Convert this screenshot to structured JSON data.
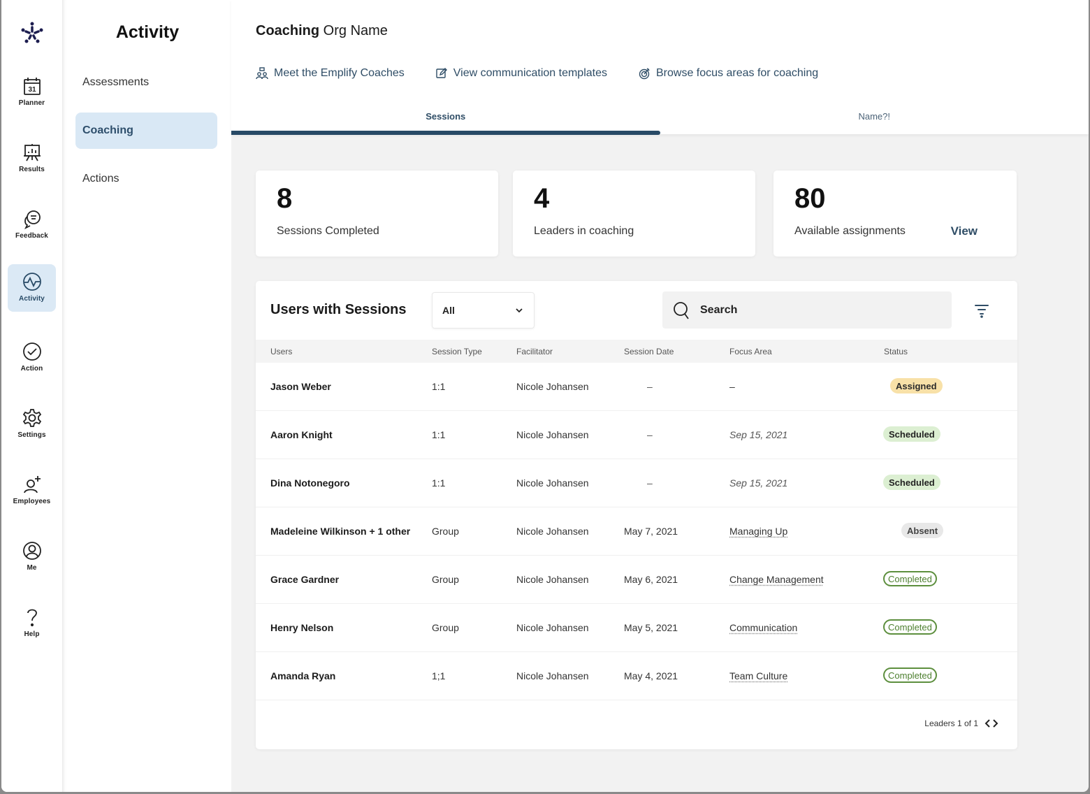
{
  "rail": {
    "items": [
      {
        "label": "Planner",
        "icon": "calendar-icon",
        "day": "31"
      },
      {
        "label": "Results",
        "icon": "presentation-chart-icon"
      },
      {
        "label": "Feedback",
        "icon": "chat-bubbles-icon"
      },
      {
        "label": "Activity",
        "icon": "activity-pulse-icon",
        "active": true
      },
      {
        "label": "Action",
        "icon": "check-circle-icon"
      },
      {
        "label": "Settings",
        "icon": "gear-icon"
      },
      {
        "label": "Employees",
        "icon": "add-user-icon"
      },
      {
        "label": "Me",
        "icon": "user-circle-icon"
      },
      {
        "label": "Help",
        "icon": "question-icon"
      }
    ]
  },
  "subnav": {
    "title": "Activity",
    "items": [
      {
        "label": "Assessments"
      },
      {
        "label": "Coaching",
        "active": true
      },
      {
        "label": "Actions"
      }
    ]
  },
  "header": {
    "title_bold": "Coaching",
    "title_rest": " Org Name",
    "links": [
      {
        "label": "Meet the Emplify Coaches",
        "icon": "coaches-icon"
      },
      {
        "label": "View communication templates",
        "icon": "edit-icon"
      },
      {
        "label": "Browse focus areas for coaching",
        "icon": "target-icon"
      }
    ],
    "tabs": [
      {
        "label": "Sessions",
        "active": true
      },
      {
        "label": "Name?!"
      }
    ]
  },
  "stats": [
    {
      "value": "8",
      "caption": "Sessions Completed"
    },
    {
      "value": "4",
      "caption": "Leaders in coaching"
    },
    {
      "value": "80",
      "caption": "Available assignments",
      "action": "View"
    }
  ],
  "table": {
    "title": "Users with Sessions",
    "filter_value": "All",
    "search_placeholder": "Search",
    "columns": [
      "Users",
      "Session Type",
      "Facilitator",
      "Session Date",
      "Focus Area",
      "Status"
    ],
    "rows": [
      {
        "user": "Jason Weber",
        "type": "1:1",
        "facilitator": "Nicole Johansen",
        "date": "–",
        "focus": "–",
        "status": "Assigned"
      },
      {
        "user": "Aaron Knight",
        "type": "1:1",
        "facilitator": "Nicole Johansen",
        "date": "–",
        "focus": "Sep 15, 2021",
        "status": "Scheduled"
      },
      {
        "user": "Dina Notonegoro",
        "type": "1:1",
        "facilitator": "Nicole Johansen",
        "date": "–",
        "focus": "Sep 15, 2021",
        "status": "Scheduled"
      },
      {
        "user": "Madeleine Wilkinson + 1 other",
        "type": "Group",
        "facilitator": "Nicole Johansen",
        "date": "May 7, 2021",
        "focus": "Managing Up",
        "status": "Absent"
      },
      {
        "user": "Grace Gardner",
        "type": "Group",
        "facilitator": "Nicole Johansen",
        "date": "May 6, 2021",
        "focus": "Change Management",
        "status": "Completed"
      },
      {
        "user": "Henry Nelson",
        "type": "Group",
        "facilitator": "Nicole Johansen",
        "date": "May 5, 2021",
        "focus": "Communication",
        "status": "Completed"
      },
      {
        "user": "Amanda Ryan",
        "type": "1;1",
        "facilitator": "Nicole Johansen",
        "date": "May 4, 2021",
        "focus": "Team Culture",
        "status": "Completed"
      }
    ],
    "pager_label": "Leaders 1 of 1"
  },
  "colors": {
    "brand": "#1c1d4f",
    "accent": "#2f4d66",
    "active_bg": "#d9e8f5",
    "assigned": "#f8e1a8",
    "scheduled": "#dcefd2",
    "completed": "#5d8f3e"
  }
}
